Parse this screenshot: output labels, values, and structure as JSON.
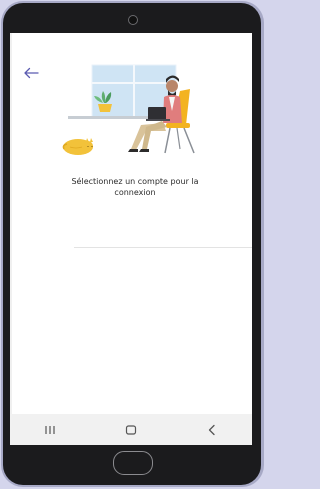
{
  "screen": {
    "prompt_line1": "Sélectionnez un compte pour la",
    "prompt_line2": "connexion"
  },
  "icons": {
    "back": "arrow-left-icon",
    "recents": "recents-icon",
    "home": "home-icon",
    "nav_back": "nav-back-icon"
  },
  "colors": {
    "accent": "#5b5bb0",
    "plant_pot": "#f2c23a",
    "cat": "#f2c23a",
    "chair": "#f3b320",
    "window": "#cfe4f4"
  }
}
